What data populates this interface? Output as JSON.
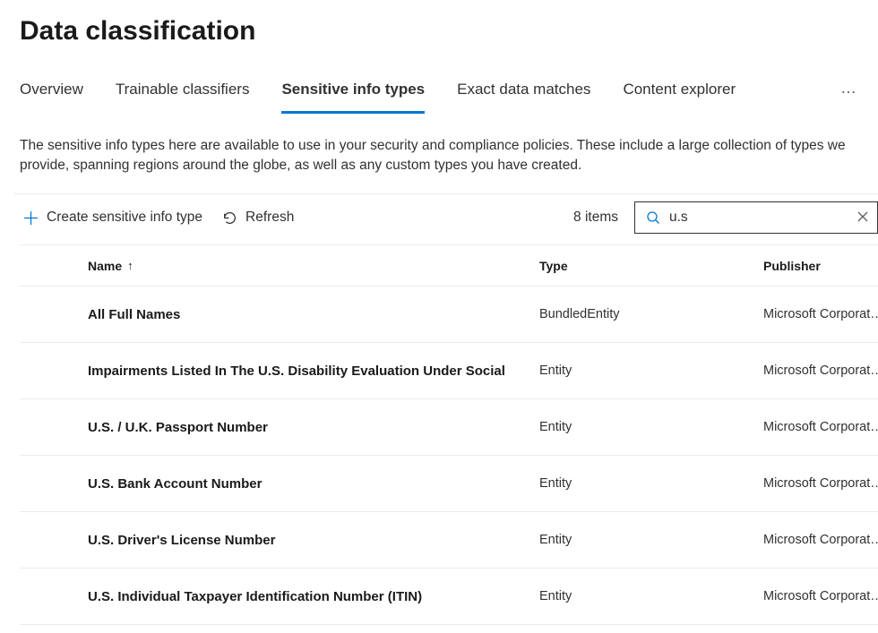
{
  "header": {
    "title": "Data classification"
  },
  "tabs": {
    "items": [
      {
        "label": "Overview",
        "active": false
      },
      {
        "label": "Trainable classifiers",
        "active": false
      },
      {
        "label": "Sensitive info types",
        "active": true
      },
      {
        "label": "Exact data matches",
        "active": false
      },
      {
        "label": "Content explorer",
        "active": false
      }
    ],
    "overflow": "…"
  },
  "description": "The sensitive info types here are available to use in your security and compliance policies. These include a large collection of types we provide, spanning regions around the globe, as well as any custom types you have created.",
  "toolbar": {
    "create_label": "Create sensitive info type",
    "refresh_label": "Refresh",
    "item_count": "8 items",
    "search_value": "u.s"
  },
  "table": {
    "columns": {
      "name": "Name",
      "type": "Type",
      "publisher": "Publisher"
    },
    "sort_indicator": "↑",
    "rows": [
      {
        "name": "All Full Names",
        "type": "BundledEntity",
        "publisher": "Microsoft Corporat…"
      },
      {
        "name": "Impairments Listed In The U.S. Disability Evaluation Under Social",
        "type": "Entity",
        "publisher": "Microsoft Corporat…"
      },
      {
        "name": "U.S. / U.K. Passport Number",
        "type": "Entity",
        "publisher": "Microsoft Corporat…"
      },
      {
        "name": "U.S. Bank Account Number",
        "type": "Entity",
        "publisher": "Microsoft Corporat…"
      },
      {
        "name": "U.S. Driver's License Number",
        "type": "Entity",
        "publisher": "Microsoft Corporat…"
      },
      {
        "name": "U.S. Individual Taxpayer Identification Number (ITIN)",
        "type": "Entity",
        "publisher": "Microsoft Corporat…"
      }
    ]
  }
}
